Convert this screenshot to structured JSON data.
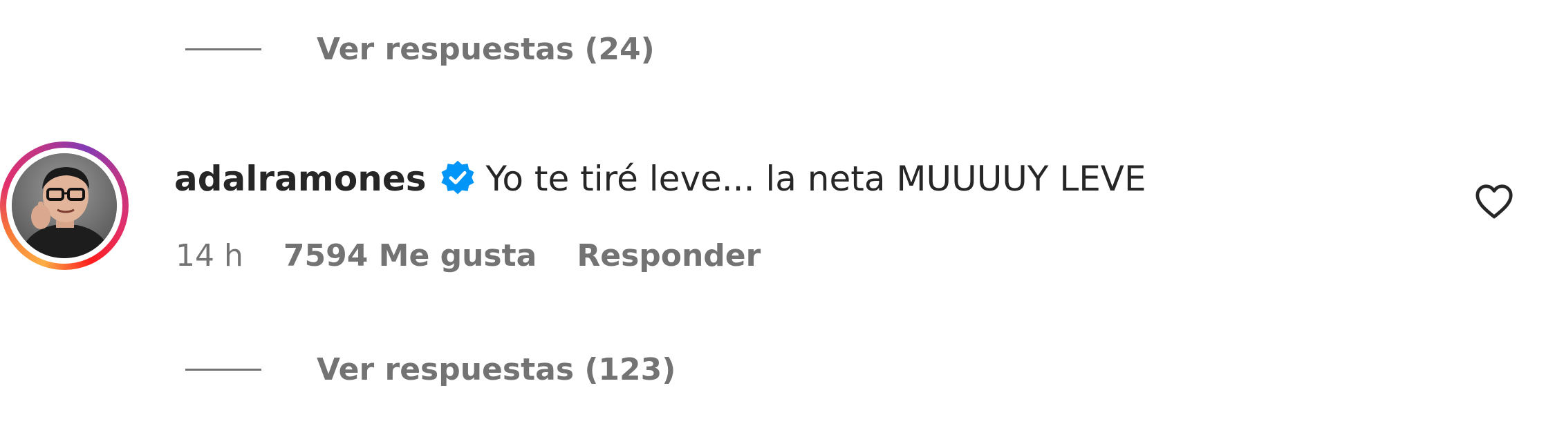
{
  "replies_top": {
    "label": "Ver respuestas (24)"
  },
  "comment": {
    "username": "adalramones",
    "verified": true,
    "text": "Yo te tiré leve... la neta MUUUUY LEVE",
    "time": "14 h",
    "likes": "7594 Me gusta",
    "reply_label": "Responder",
    "like_icon": "heart-outline-icon"
  },
  "replies_bottom": {
    "label": "Ver respuestas (123)"
  },
  "colors": {
    "text_primary": "#262626",
    "text_secondary": "#737373",
    "verified_blue": "#0095f6"
  }
}
